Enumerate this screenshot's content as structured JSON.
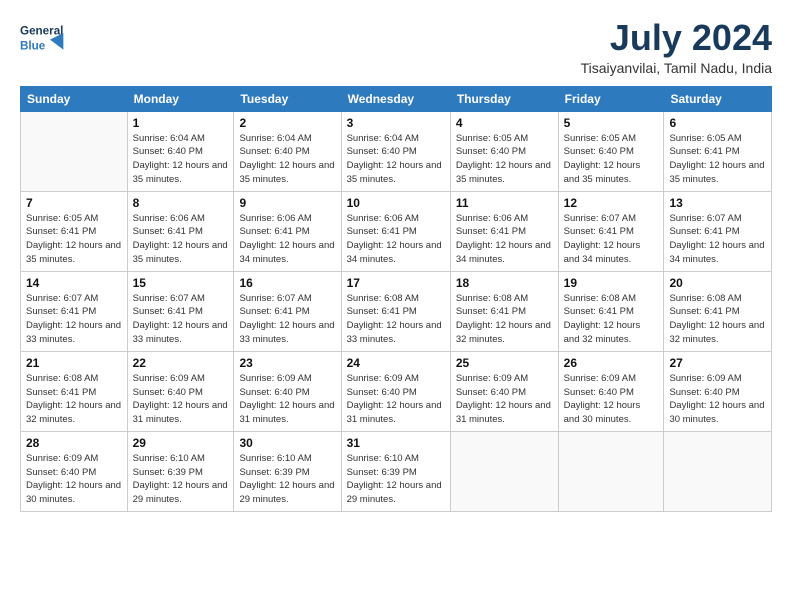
{
  "header": {
    "logo_general": "General",
    "logo_blue": "Blue",
    "title": "July 2024",
    "location": "Tisaiyanvilai, Tamil Nadu, India"
  },
  "days_of_week": [
    "Sunday",
    "Monday",
    "Tuesday",
    "Wednesday",
    "Thursday",
    "Friday",
    "Saturday"
  ],
  "weeks": [
    [
      {
        "day": "",
        "sunrise": "",
        "sunset": "",
        "daylight": ""
      },
      {
        "day": "1",
        "sunrise": "Sunrise: 6:04 AM",
        "sunset": "Sunset: 6:40 PM",
        "daylight": "Daylight: 12 hours and 35 minutes."
      },
      {
        "day": "2",
        "sunrise": "Sunrise: 6:04 AM",
        "sunset": "Sunset: 6:40 PM",
        "daylight": "Daylight: 12 hours and 35 minutes."
      },
      {
        "day": "3",
        "sunrise": "Sunrise: 6:04 AM",
        "sunset": "Sunset: 6:40 PM",
        "daylight": "Daylight: 12 hours and 35 minutes."
      },
      {
        "day": "4",
        "sunrise": "Sunrise: 6:05 AM",
        "sunset": "Sunset: 6:40 PM",
        "daylight": "Daylight: 12 hours and 35 minutes."
      },
      {
        "day": "5",
        "sunrise": "Sunrise: 6:05 AM",
        "sunset": "Sunset: 6:40 PM",
        "daylight": "Daylight: 12 hours and 35 minutes."
      },
      {
        "day": "6",
        "sunrise": "Sunrise: 6:05 AM",
        "sunset": "Sunset: 6:41 PM",
        "daylight": "Daylight: 12 hours and 35 minutes."
      }
    ],
    [
      {
        "day": "7",
        "sunrise": "Sunrise: 6:05 AM",
        "sunset": "Sunset: 6:41 PM",
        "daylight": "Daylight: 12 hours and 35 minutes."
      },
      {
        "day": "8",
        "sunrise": "Sunrise: 6:06 AM",
        "sunset": "Sunset: 6:41 PM",
        "daylight": "Daylight: 12 hours and 35 minutes."
      },
      {
        "day": "9",
        "sunrise": "Sunrise: 6:06 AM",
        "sunset": "Sunset: 6:41 PM",
        "daylight": "Daylight: 12 hours and 34 minutes."
      },
      {
        "day": "10",
        "sunrise": "Sunrise: 6:06 AM",
        "sunset": "Sunset: 6:41 PM",
        "daylight": "Daylight: 12 hours and 34 minutes."
      },
      {
        "day": "11",
        "sunrise": "Sunrise: 6:06 AM",
        "sunset": "Sunset: 6:41 PM",
        "daylight": "Daylight: 12 hours and 34 minutes."
      },
      {
        "day": "12",
        "sunrise": "Sunrise: 6:07 AM",
        "sunset": "Sunset: 6:41 PM",
        "daylight": "Daylight: 12 hours and 34 minutes."
      },
      {
        "day": "13",
        "sunrise": "Sunrise: 6:07 AM",
        "sunset": "Sunset: 6:41 PM",
        "daylight": "Daylight: 12 hours and 34 minutes."
      }
    ],
    [
      {
        "day": "14",
        "sunrise": "Sunrise: 6:07 AM",
        "sunset": "Sunset: 6:41 PM",
        "daylight": "Daylight: 12 hours and 33 minutes."
      },
      {
        "day": "15",
        "sunrise": "Sunrise: 6:07 AM",
        "sunset": "Sunset: 6:41 PM",
        "daylight": "Daylight: 12 hours and 33 minutes."
      },
      {
        "day": "16",
        "sunrise": "Sunrise: 6:07 AM",
        "sunset": "Sunset: 6:41 PM",
        "daylight": "Daylight: 12 hours and 33 minutes."
      },
      {
        "day": "17",
        "sunrise": "Sunrise: 6:08 AM",
        "sunset": "Sunset: 6:41 PM",
        "daylight": "Daylight: 12 hours and 33 minutes."
      },
      {
        "day": "18",
        "sunrise": "Sunrise: 6:08 AM",
        "sunset": "Sunset: 6:41 PM",
        "daylight": "Daylight: 12 hours and 32 minutes."
      },
      {
        "day": "19",
        "sunrise": "Sunrise: 6:08 AM",
        "sunset": "Sunset: 6:41 PM",
        "daylight": "Daylight: 12 hours and 32 minutes."
      },
      {
        "day": "20",
        "sunrise": "Sunrise: 6:08 AM",
        "sunset": "Sunset: 6:41 PM",
        "daylight": "Daylight: 12 hours and 32 minutes."
      }
    ],
    [
      {
        "day": "21",
        "sunrise": "Sunrise: 6:08 AM",
        "sunset": "Sunset: 6:41 PM",
        "daylight": "Daylight: 12 hours and 32 minutes."
      },
      {
        "day": "22",
        "sunrise": "Sunrise: 6:09 AM",
        "sunset": "Sunset: 6:40 PM",
        "daylight": "Daylight: 12 hours and 31 minutes."
      },
      {
        "day": "23",
        "sunrise": "Sunrise: 6:09 AM",
        "sunset": "Sunset: 6:40 PM",
        "daylight": "Daylight: 12 hours and 31 minutes."
      },
      {
        "day": "24",
        "sunrise": "Sunrise: 6:09 AM",
        "sunset": "Sunset: 6:40 PM",
        "daylight": "Daylight: 12 hours and 31 minutes."
      },
      {
        "day": "25",
        "sunrise": "Sunrise: 6:09 AM",
        "sunset": "Sunset: 6:40 PM",
        "daylight": "Daylight: 12 hours and 31 minutes."
      },
      {
        "day": "26",
        "sunrise": "Sunrise: 6:09 AM",
        "sunset": "Sunset: 6:40 PM",
        "daylight": "Daylight: 12 hours and 30 minutes."
      },
      {
        "day": "27",
        "sunrise": "Sunrise: 6:09 AM",
        "sunset": "Sunset: 6:40 PM",
        "daylight": "Daylight: 12 hours and 30 minutes."
      }
    ],
    [
      {
        "day": "28",
        "sunrise": "Sunrise: 6:09 AM",
        "sunset": "Sunset: 6:40 PM",
        "daylight": "Daylight: 12 hours and 30 minutes."
      },
      {
        "day": "29",
        "sunrise": "Sunrise: 6:10 AM",
        "sunset": "Sunset: 6:39 PM",
        "daylight": "Daylight: 12 hours and 29 minutes."
      },
      {
        "day": "30",
        "sunrise": "Sunrise: 6:10 AM",
        "sunset": "Sunset: 6:39 PM",
        "daylight": "Daylight: 12 hours and 29 minutes."
      },
      {
        "day": "31",
        "sunrise": "Sunrise: 6:10 AM",
        "sunset": "Sunset: 6:39 PM",
        "daylight": "Daylight: 12 hours and 29 minutes."
      },
      {
        "day": "",
        "sunrise": "",
        "sunset": "",
        "daylight": ""
      },
      {
        "day": "",
        "sunrise": "",
        "sunset": "",
        "daylight": ""
      },
      {
        "day": "",
        "sunrise": "",
        "sunset": "",
        "daylight": ""
      }
    ]
  ]
}
